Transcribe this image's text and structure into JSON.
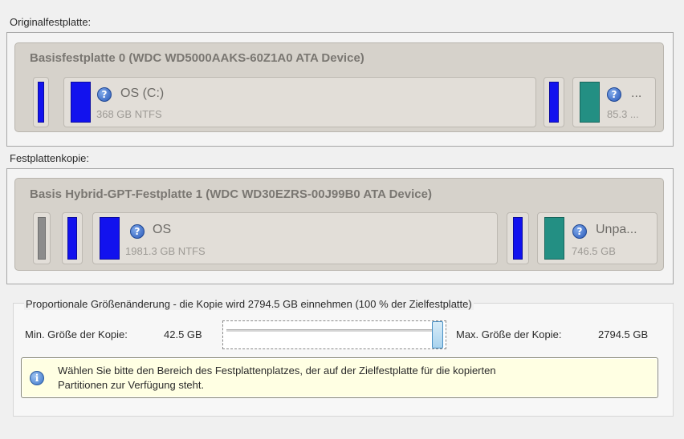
{
  "source": {
    "caption": "Originalfestplatte:",
    "disk_title": "Basisfestplatte 0 (WDC WD5000AAKS-60Z1A0 ATA Device)",
    "partitions": [
      {
        "name": "OS (C:)",
        "size": "368 GB NTFS",
        "icon": "help-icon",
        "color": "#1212ee"
      },
      {
        "name": "...",
        "size": "85.3 ...",
        "icon": "help-icon",
        "color": "#238f83"
      }
    ]
  },
  "target": {
    "caption": "Festplattenkopie:",
    "disk_title": "Basis Hybrid-GPT-Festplatte 1 (WDC WD30EZRS-00J99B0 ATA Device)",
    "partitions": [
      {
        "name": "OS",
        "size": "1981.3 GB NTFS",
        "icon": "help-icon",
        "color": "#1212ee"
      },
      {
        "name": "Unpa...",
        "size": "746.5 GB",
        "icon": "help-icon",
        "color": "#238f83"
      }
    ]
  },
  "resize": {
    "legend": "Proportionale Größenänderung - die Kopie wird 2794.5 GB einnehmen (100 % der Zielfestplatte)",
    "min_label": "Min. Größe der Kopie:",
    "min_value": "42.5 GB",
    "max_label": "Max. Größe der Kopie:",
    "max_value": "2794.5 GB",
    "slider_fraction": 1.0
  },
  "info": {
    "icon": "info-icon",
    "text_line1": "Wählen Sie bitte den Bereich des Festplattenplatzes, der auf der Zielfestplatte für die kopierten",
    "text_line2": "Partitionen zur Verfügung steht."
  },
  "colors": {
    "primary_partition": "#1212ee",
    "unallocated": "#238f83",
    "hidden_partition": "#8c8c8c"
  }
}
